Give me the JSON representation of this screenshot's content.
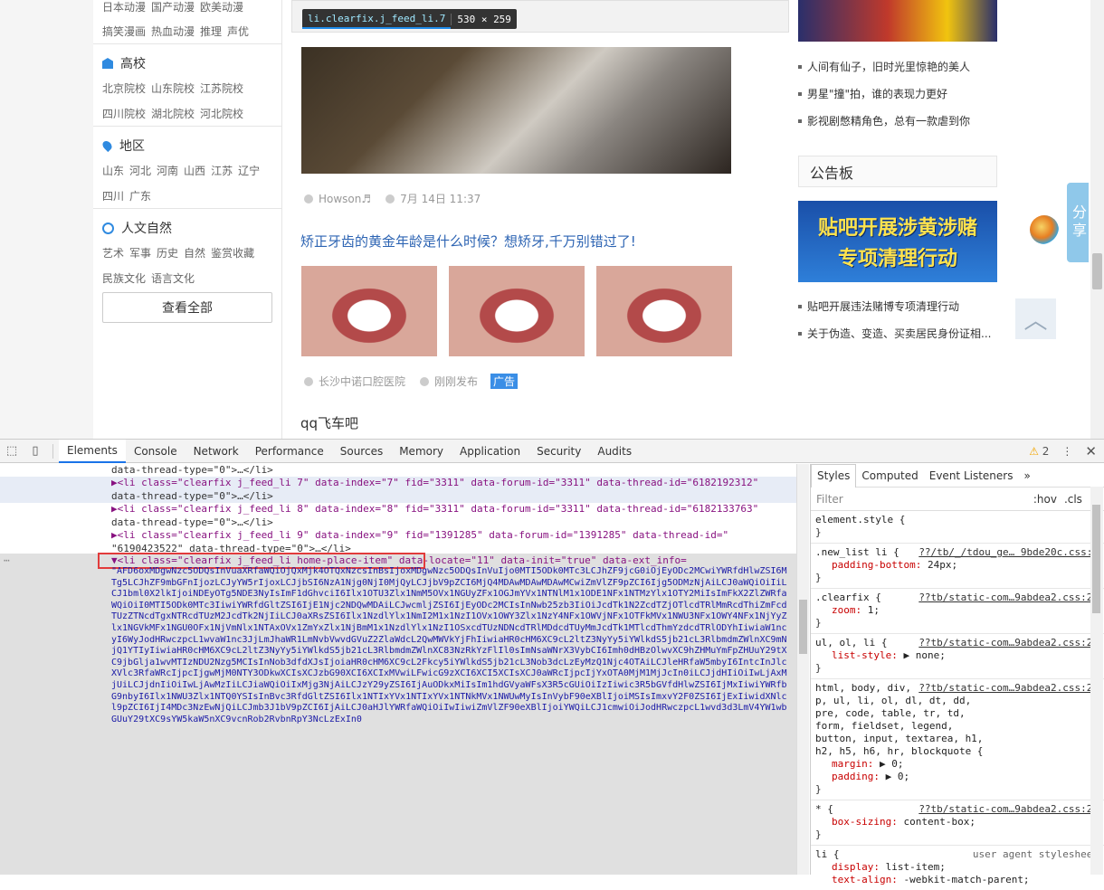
{
  "sidebar": {
    "top_links_1": [
      "日本动漫",
      "国产动漫",
      "欧美动漫"
    ],
    "top_links_2": [
      "搞笑漫画",
      "热血动漫",
      "推理",
      "声优"
    ],
    "sections": [
      {
        "title": "高校",
        "rows": [
          [
            "北京院校",
            "山东院校",
            "江苏院校"
          ],
          [
            "四川院校",
            "湖北院校",
            "河北院校"
          ]
        ]
      },
      {
        "title": "地区",
        "rows": [
          [
            "山东",
            "河北",
            "河南",
            "山西",
            "江苏",
            "辽宁"
          ],
          [
            "四川",
            "广东"
          ]
        ]
      },
      {
        "title": "人文自然",
        "rows": [
          [
            "艺术",
            "军事",
            "历史",
            "自然",
            "鉴赏收藏"
          ],
          [
            "民族文化",
            "语言文化"
          ]
        ]
      }
    ],
    "view_all": "查看全部"
  },
  "tooltip": {
    "selector": "li.clearfix.j_feed_li.7",
    "size": "530 × 259"
  },
  "post1": {
    "author": "Howson♬",
    "time": "7月 14日 11:37"
  },
  "post2": {
    "title": "矫正牙齿的黄金年龄是什么时候？想矫牙,千万别错过了!",
    "author": "长沙中诺口腔医院",
    "time": "刚刚发布",
    "ad": "广告"
  },
  "post3": {
    "title": "qq飞车吧"
  },
  "right": {
    "links1": [
      "人间有仙子，旧时光里惊艳的美人",
      "男星\"撞\"拍，谁的表现力更好",
      "影视剧憋精角色，总有一款虐到你"
    ],
    "notice_title": "公告板",
    "notice_banner_line1": "贴吧开展涉黄涉赌",
    "notice_banner_line2": "专项清理行动",
    "links2": [
      "贴吧开展违法赌博专项清理行动",
      "关于伪造、变造、买卖居民身份证相..."
    ]
  },
  "float": {
    "share": "分享"
  },
  "devtools": {
    "tabs": [
      "Elements",
      "Console",
      "Network",
      "Performance",
      "Sources",
      "Memory",
      "Application",
      "Security",
      "Audits"
    ],
    "warn_count": "2",
    "lines": [
      {
        "text": "data-thread-type=\"0\">…</li>"
      },
      {
        "text": "▶<li class=\"clearfix j_feed_li  7\" data-index=\"7\" fid=\"3311\" data-forum-id=\"3311\" data-thread-id=\"6182192312\""
      },
      {
        "text": "data-thread-type=\"0\">…</li>"
      },
      {
        "text": "▶<li class=\"clearfix j_feed_li  8\" data-index=\"8\" fid=\"3311\" data-forum-id=\"3311\" data-thread-id=\"6182133763\""
      },
      {
        "text": "data-thread-type=\"0\">…</li>"
      },
      {
        "text": "▶<li class=\"clearfix j_feed_li  9\" data-index=\"9\" fid=\"1391285\" data-forum-id=\"1391285\" data-thread-id=\""
      },
      {
        "text": "\"6190423522\" data-thread-type=\"0\">…</li>"
      },
      {
        "text": "▼<li class=\"clearfix j_feed_li home-place-item\" data-locate=\"11\" data-init=\"true\" data-ext_info="
      }
    ],
    "b64": "\"AFD6oxMDgwNzc5ODQsInVuaXRfaWQiOjQxMjk4OTQxNzcsInBsIjoxMDgwNzc5ODQsInVuIjo0MTI5ODk0MTc3LCJhZF9jcG0iOjEyODc2MCwiYWRfdHlwZSI6MTg5LCJhZF9mbGFnIjozLCJyYW5rIjoxLCJjbSI6NzA1Njg0NjI0MjQyLCJjbV9pZCI6MjQ4MDAwMDAwMDAwMCwiZmVlZF9pZCI6Ijg5ODMzNjAiLCJ0aWQiOiIiLCJ1bml0X2lkIjoiNDEyOTg5NDE3NyIsImF1dGhvciI6Ilx1OTU3Zlx1NmM5OVx1NGUyZFx1OGJmYVx1NTNlM1x1ODE1NFx1NTMzYlx1OTY2MiIsImFkX2ZlZWRfaWQiOiI0MTI5ODk0MTc3IiwiYWRfdGltZSI6IjE1Njc2NDQwMDAiLCJwcmljZSI6IjEyODc2MCIsInNwb25zb3IiOiJcdTk1N2ZcdTZjOTlcdTRlMmRcdThiZmFcdTUzZTNcdTgxNTRcdTUzM2JcdTk2NjIiLCJ0aXRsZSI6Ilx1NzdlYlx1NmI2M1x1NzI1OVx1OWY3Zlx1NzY4NFx1OWVjNFx1OTFkMVx1NWU3NFx1OWY4NFx1NjYyZlx1NGVkMFx1NGU0OFx1NjVmNlx1NTAxOVx1ZmYxZlx1NjBmM1x1NzdlYlx1NzI1OSxcdTUzNDNcdTRlMDdcdTUyMmJcdTk1MTlcdThmYzdcdTRlODYhIiwiaW1ncyI6WyJodHRwczpcL1wvaW1nc3JjLmJhaWR1LmNvbVwvdGVuZ2ZlaWdcL2QwMWVkYjFhIiwiaHR0cHM6XC9cL2ltZ3NyYy5iYWlkdS5jb21cL3RlbmdmZWlnXC9mNjQ1YTIyIiwiaHR0cHM6XC9cL2ltZ3NyYy5iYWlkdS5jb21cL3RlbmdmZWlnXC83NzRkYzFlIl0sImNsaWNrX3VybCI6Imh0dHBzOlwvXC9hZHMuYmFpZHUuY29tXC9jbGlja1wvMTIzNDU2Nzg5MCIsInNob3dfdXJsIjoiaHR0cHM6XC9cL2Fkcy5iYWlkdS5jb21cL3Nob3dcLzEyMzQ1Njc4OTAiLCJleHRfaW5mbyI6IntcInJlcXVlc3RfaWRcIjpcIjgwMjM0NTY3ODkwXCIsXCJzbG90XCI6XCIxMVwiLFwicG9zXCI6XCI5XCIsXCJ0aWRcIjpcIjYxOTA0MjM1MjJcIn0iLCJjdHIiOiIwLjAxMjUiLCJjdnIiOiIwLjAwMzIiLCJiaWQiOiIxMjg3NjAiLCJzY29yZSI6IjAuODkxMiIsIm1hdGVyaWFsX3R5cGUiOiIzIiwic3R5bGVfdHlwZSI6IjMxIiwiYWRfbG9nbyI6Ilx1NWU3Zlx1NTQ0YSIsInBvc3RfdGltZSI6Ilx1NTIxYVx1NTIxYVx1NTNkMVx1NWUwMyIsInVybF90eXBlIjoiMSIsImxvY2F0ZSI6IjExIiwidXNlcl9pZCI6IjI4MDc3NzEwNjQiLCJmb3J1bV9pZCI6IjAiLCJ0aHJlYWRfaWQiOiIwIiwiZmVlZF90eXBlIjoiYWQiLCJ1cmwiOiJodHRwczpcL1wvd3d3LmV4YW1wbGUuY29tXC9sYW5kaW5nXC9vcnRob2RvbnRpY3NcLzExIn0",
    "styles_tabs": [
      "Styles",
      "Computed",
      "Event Listeners"
    ],
    "filter": "Filter",
    "hov": ":hov",
    "cls": ".cls",
    "rules": [
      {
        "sel": "element.style {",
        "src": "",
        "props": []
      },
      {
        "sel": ".new_list li {",
        "src": "??/tb/_/tdou_ge… 9bde20c.css:3",
        "props": [
          [
            "padding-bottom",
            "24px;"
          ]
        ]
      },
      {
        "sel": ".clearfix {",
        "src": "??tb/static-com…9abdea2.css:28",
        "props": [
          [
            "zoom",
            "1;"
          ]
        ]
      },
      {
        "sel": "ul, ol, li {",
        "src": "??tb/static-com…9abdea2.css:28",
        "props": [
          [
            "list-style",
            "▶ none;"
          ]
        ]
      },
      {
        "sel": "html, body, div, p, ul, li, ol, dl, dt, dd, pre, code, table, tr, td, form, fieldset, legend, button, input, textarea, h1, h2, h5, h6, hr, blockquote {",
        "src": "??tb/static-com…9abdea2.css:28",
        "props": [
          [
            "margin",
            "▶ 0;"
          ],
          [
            "padding",
            "▶ 0;"
          ]
        ]
      },
      {
        "sel": "* {",
        "src": "??tb/static-com…9abdea2.css:28",
        "props": [
          [
            "box-sizing",
            "content-box;"
          ]
        ]
      },
      {
        "sel": "li {",
        "src": "user agent stylesheet",
        "props": [
          [
            "display",
            "list-item;"
          ],
          [
            "text-align",
            "-webkit-match-parent;"
          ]
        ]
      }
    ]
  }
}
